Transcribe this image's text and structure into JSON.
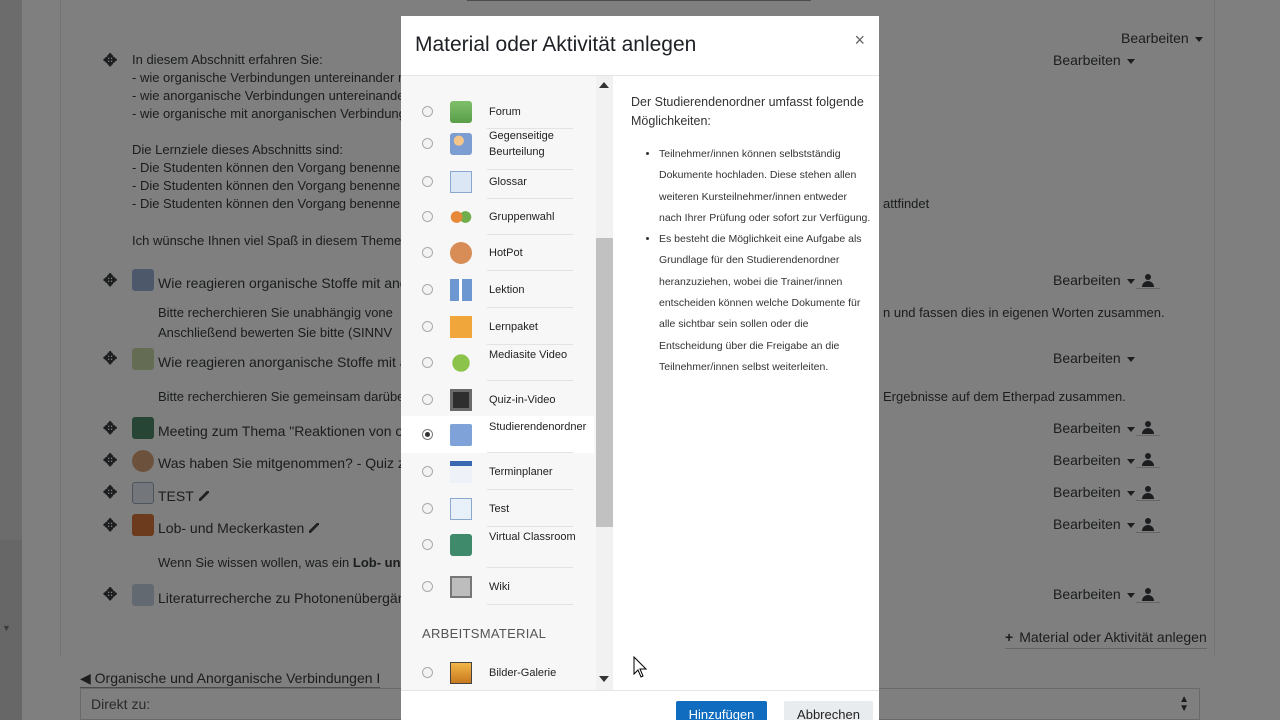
{
  "background": {
    "section_edit_label": "Bearbeiten",
    "summary_lines": [
      "In diesem Abschnitt erfahren Sie:",
      "- wie organische Verbindungen untereinander rea",
      "- wie anorganische Verbindungen untereinander",
      "- wie organische mit anorganischen Verbindunge",
      "",
      "Die Lernziele dieses Abschnitts sind:",
      "- Die Studenten können den Vorgang benennen u",
      "- Die Studenten können den Vorgang benennen u",
      "- Die Studenten können den Vorgang benennen u",
      "",
      "Ich wünsche Ihnen viel Spaß in diesem Themenb"
    ],
    "summary_tail": "attfindet",
    "activities": [
      {
        "title": "Wie reagieren organische Stoffe mit ande",
        "edit": "Bearbeiten",
        "desc1": "Bitte recherchieren Sie unabhängig vone",
        "desc1_tail": "n und fassen dies in eigenen Worten zusammen.",
        "desc2": "Anschließend bewerten Sie bitte (SINNV"
      },
      {
        "title": "Wie reagieren anorganische Stoffe mit an",
        "edit": "Bearbeiten",
        "desc1": "Bitte recherchieren Sie gemeinsam darüber,",
        "desc1_tail": "Ergebnisse auf dem Etherpad zusammen."
      },
      {
        "title": "Meeting zum Thema \"Reaktionen von org",
        "edit": "Bearbeiten"
      },
      {
        "title": "Was haben Sie mitgenommen? - Quiz zu",
        "edit": "Bearbeiten"
      },
      {
        "title": "TEST",
        "edit": "Bearbeiten"
      },
      {
        "title": "Lob- und Meckerkasten",
        "edit": "Bearbeiten",
        "desc1": "Wenn Sie wissen wollen, was ein",
        "desc1_bold": "Lob- und"
      },
      {
        "title": "Literaturrecherche zu Photonenübergäng",
        "edit": "Bearbeiten"
      }
    ],
    "add_activity_label": "Material oder Aktivität anlegen",
    "prev_section_label": "◀ Organische und Anorganische Verbindungen I",
    "jump_to_label": "Direkt zu:"
  },
  "modal": {
    "title": "Material oder Aktivität anlegen",
    "close_label": "×",
    "options": [
      {
        "label": "Forum",
        "icon": "forum-icon"
      },
      {
        "label": "Gegenseitige Beurteilung",
        "icon": "workshop-icon"
      },
      {
        "label": "Glossar",
        "icon": "glossary-icon"
      },
      {
        "label": "Gruppenwahl",
        "icon": "group-choice-icon"
      },
      {
        "label": "HotPot",
        "icon": "hotpot-icon"
      },
      {
        "label": "Lektion",
        "icon": "lesson-icon"
      },
      {
        "label": "Lernpaket",
        "icon": "scorm-package-icon"
      },
      {
        "label": "Mediasite Video",
        "icon": "mediasite-icon"
      },
      {
        "label": "Quiz-in-Video",
        "icon": "video-quiz-icon"
      },
      {
        "label": "Studierendenordner",
        "icon": "student-folder-icon",
        "selected": true
      },
      {
        "label": "Terminplaner",
        "icon": "scheduler-icon"
      },
      {
        "label": "Test",
        "icon": "test-icon"
      },
      {
        "label": "Virtual Classroom",
        "icon": "virtual-classroom-icon"
      },
      {
        "label": "Wiki",
        "icon": "wiki-icon"
      }
    ],
    "resource_heading": "ARBEITSMATERIAL",
    "resource_options": [
      {
        "label": "Bilder-Galerie",
        "icon": "image-gallery-icon"
      }
    ],
    "description": {
      "intro": "Der Studierendenordner umfasst folgende Möglichkeiten:",
      "bullets": [
        "Teilnehmer/innen können selbstständig Dokumente hochladen. Diese stehen allen weiteren Kursteilnehmer/innen entweder nach Ihrer Prüfung oder sofort zur Verfügung.",
        "Es besteht die Möglichkeit eine Aufgabe als Grundlage für den Studierendenordner heranzuziehen, wobei die Trainer/innen entscheiden können welche Dokumente für alle sichtbar sein sollen oder die Entscheidung über die Freigabe an die Teilnehmer/innen selbst weiterleiten."
      ]
    },
    "add_button_label": "Hinzufügen",
    "cancel_button_label": "Abbrechen"
  },
  "colors": {
    "primary": "#0f6cbf",
    "overlay": "rgba(0,0,0,0.5)",
    "list_background": "#f7f7f7"
  }
}
